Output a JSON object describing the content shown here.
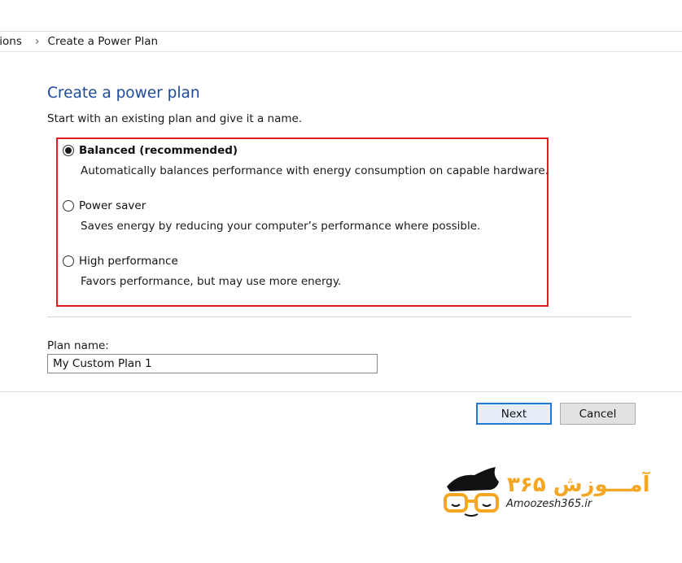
{
  "breadcrumb": {
    "previous": "tions",
    "current": "Create a Power Plan"
  },
  "page": {
    "title": "Create a power plan",
    "subtitle": "Start with an existing plan and give it a name."
  },
  "plans": [
    {
      "label": "Balanced (recommended)",
      "description": "Automatically balances performance with energy consumption on capable hardware.",
      "selected": true
    },
    {
      "label": "Power saver",
      "description": "Saves energy by reducing your computer’s performance where possible.",
      "selected": false
    },
    {
      "label": "High performance",
      "description": "Favors performance, but may use more energy.",
      "selected": false
    }
  ],
  "plan_name": {
    "label": "Plan name:",
    "value": "My Custom Plan 1"
  },
  "buttons": {
    "next": "Next",
    "cancel": "Cancel"
  },
  "watermark": {
    "brand_fa": "آمـــوزش ۳۶۵",
    "site": "Amoozesh365.ir"
  },
  "colors": {
    "title": "#1e4a9e",
    "highlight": "#e11b22",
    "logo_orange": "#f5a623"
  }
}
